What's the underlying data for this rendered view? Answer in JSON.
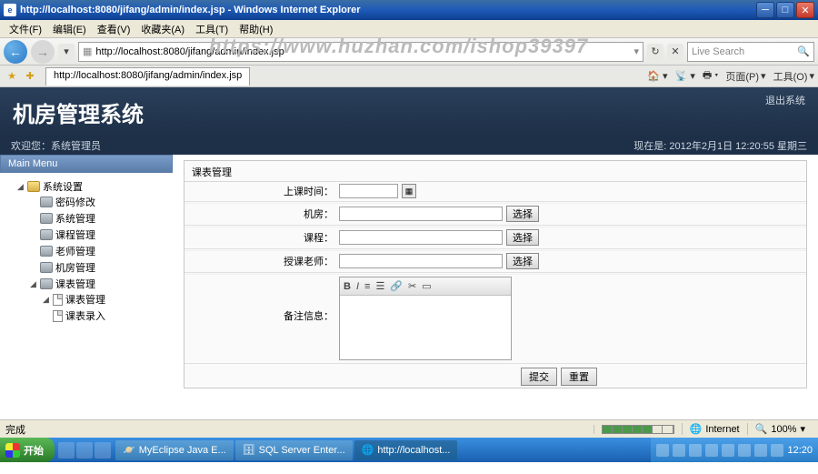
{
  "titlebar": {
    "url_title": "http://localhost:8080/jifang/admin/index.jsp - Windows Internet Explorer"
  },
  "menubar": {
    "file": "文件(F)",
    "edit": "编辑(E)",
    "view": "查看(V)",
    "favorites": "收藏夹(A)",
    "tools": "工具(T)",
    "help": "帮助(H)"
  },
  "address": {
    "url": "http://localhost:8080/jifang/admin/index.jsp"
  },
  "search": {
    "placeholder": "Live Search"
  },
  "tab": {
    "title": "http://localhost:8080/jifang/admin/index.jsp"
  },
  "toolbar_right": {
    "page": "页面(P)",
    "tools": "工具(O)"
  },
  "watermark": "https://www.huzhan.com/ishop39397",
  "app": {
    "title": "机房管理系统",
    "logout": "退出系统",
    "welcome_prefix": "欢迎您：",
    "welcome_user": "系统管理员",
    "now_prefix": "现在是:",
    "now_time": "2012年2月1日 12:20:55 星期三"
  },
  "sidebar": {
    "header": "Main Menu",
    "root": "系统设置",
    "items": {
      "pwd": "密码修改",
      "sys": "系统管理",
      "course": "课程管理",
      "teacher": "老师管理",
      "room": "机房管理",
      "schedule": "课表管理",
      "sched_mgmt": "课表管理",
      "sched_import": "课表录入"
    }
  },
  "panel": {
    "title": "课表管理",
    "labels": {
      "time": "上课时间：",
      "room": "机房：",
      "course": "课程：",
      "teacher": "授课老师：",
      "remark": "备注信息："
    },
    "select_btn": "选择",
    "submit": "提交",
    "reset": "重置"
  },
  "statusbar": {
    "done": "完成",
    "zone": "Internet",
    "zoom": "100%"
  },
  "taskbar": {
    "start": "开始",
    "task1": "MyEclipse Java E...",
    "task2": "SQL Server Enter...",
    "task3": "http://localhost...",
    "clock": "12:20"
  }
}
